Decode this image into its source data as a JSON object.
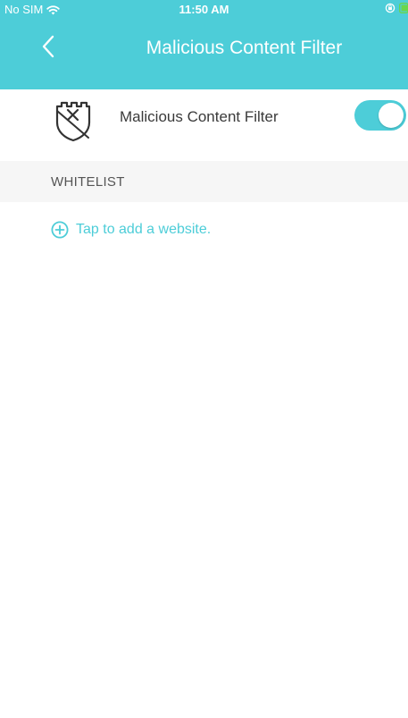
{
  "colors": {
    "accent": "#4dcdd8",
    "section_bg": "#f6f6f6",
    "text_dark": "#3a3a3a",
    "text_muted": "#555555"
  },
  "status_bar": {
    "carrier": "No SIM",
    "time": "11:50 AM",
    "icons": [
      "wifi-icon",
      "lock-rotation-icon",
      "battery-icon"
    ]
  },
  "nav": {
    "title": "Malicious Content Filter",
    "back_icon": "chevron-left-icon"
  },
  "filter": {
    "icon": "shield-x-icon",
    "label": "Malicious Content Filter",
    "enabled": true
  },
  "whitelist": {
    "section_title": "WHITELIST",
    "add_icon": "plus-circle-icon",
    "add_label": "Tap to add a website."
  }
}
